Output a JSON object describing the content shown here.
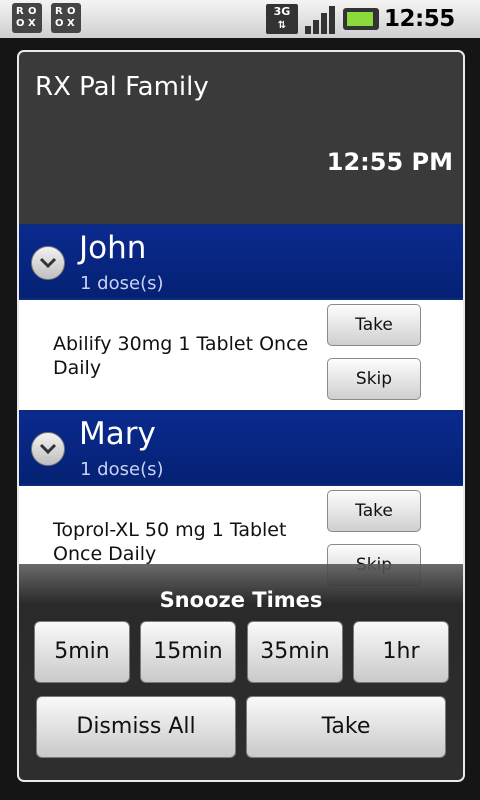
{
  "status_bar": {
    "time": "12:55",
    "ampm": "PM",
    "network": "3G",
    "notification_icon_glyphs": [
      "R",
      "O",
      "O",
      "X"
    ]
  },
  "dialog": {
    "title": "RX Pal Family",
    "clock": "12:55 PM"
  },
  "groups": [
    {
      "name": "John",
      "subtitle": "1 dose(s)",
      "medication": "Abilify 30mg 1 Tablet Once Daily",
      "take_label": "Take",
      "skip_label": "Skip"
    },
    {
      "name": "Mary",
      "subtitle": "1 dose(s)",
      "medication": "Toprol-XL 50 mg 1 Tablet Once Daily",
      "take_label": "Take",
      "skip_label": "Skip"
    }
  ],
  "snooze": {
    "title": "Snooze Times",
    "options": [
      "5min",
      "15min",
      "35min",
      "1hr"
    ],
    "dismiss_all_label": "Dismiss All",
    "take_label": "Take"
  },
  "colors": {
    "header_blue": "#052174",
    "battery_green": "#8bd93a",
    "dialog_bg": "#3a3a3a"
  }
}
